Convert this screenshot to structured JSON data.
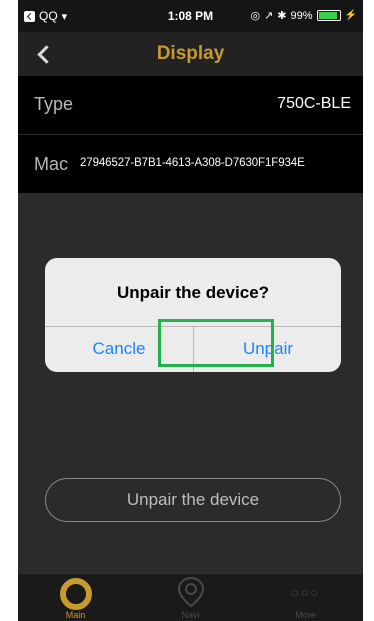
{
  "status_bar": {
    "carrier": "QQ",
    "time": "1:08 PM",
    "battery_percent": "99%",
    "battery_level": 0.99
  },
  "nav": {
    "title": "Display",
    "title_color": "#c69a2c"
  },
  "device_info": {
    "type_label": "Type",
    "type_value": "750C-BLE",
    "mac_label": "Mac",
    "mac_value": "27946527-B7B1-4613-A308-D7630F1F934E"
  },
  "dialog": {
    "title": "Unpair the device?",
    "cancel_label": "Cancle",
    "unpair_label": "Unpair",
    "button_color": "#1a84ff"
  },
  "unpair_button_label": "Unpair the device",
  "tab_bar": {
    "tabs": [
      {
        "label": "Main",
        "icon": "ring-icon",
        "active": true
      },
      {
        "label": "Navi",
        "icon": "location-pin-icon",
        "active": false
      },
      {
        "label": "More",
        "icon": "more-dots-icon",
        "active": false
      }
    ]
  },
  "colors": {
    "accent": "#c69a2c",
    "highlight": "#22b14c"
  }
}
